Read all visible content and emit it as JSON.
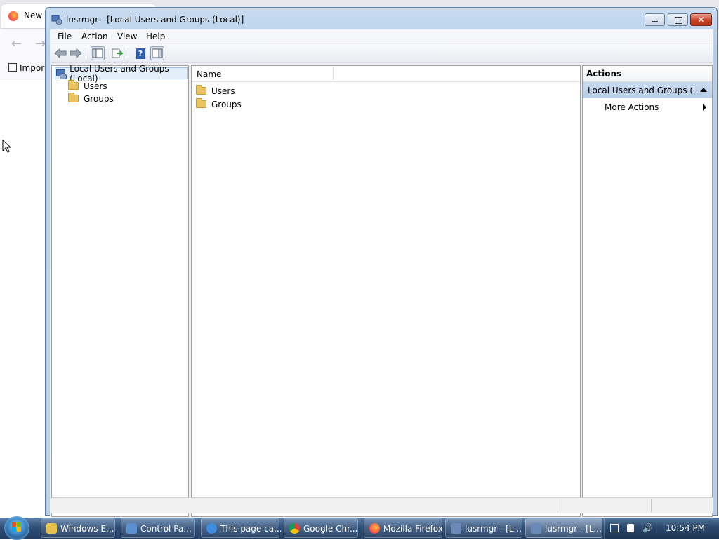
{
  "browser_bg": {
    "tab_title": "New T",
    "back_arrow": "←",
    "forward_arrow": "→",
    "bookmark_import": "Impor"
  },
  "window": {
    "title": "lusrmgr - [Local Users and Groups (Local)]",
    "close_glyph": "✕"
  },
  "menu": {
    "items": [
      "File",
      "Action",
      "View",
      "Help"
    ]
  },
  "toolbar": {
    "back_icon": "back-arrow-icon",
    "forward_icon": "forward-arrow-icon",
    "show_hide_tree_icon": "console-tree-icon",
    "export_list_icon": "export-list-icon",
    "help_icon": "help-icon",
    "help_glyph": "?",
    "show_hide_action_icon": "action-pane-icon"
  },
  "tree": {
    "root": "Local Users and Groups (Local)",
    "children": [
      "Users",
      "Groups"
    ]
  },
  "list": {
    "column_name": "Name",
    "rows": [
      "Users",
      "Groups"
    ]
  },
  "actions": {
    "title": "Actions",
    "group_label": "Local Users and Groups (Lo...",
    "more_actions": "More Actions"
  },
  "taskbar": {
    "buttons": [
      {
        "label": "Windows E...",
        "icon": "explorer-folder-icon",
        "color": "#e6c14d"
      },
      {
        "label": "Control Pa...",
        "icon": "control-panel-icon",
        "color": "#5a8fd0"
      },
      {
        "label": "This page ca...",
        "icon": "internet-explorer-icon",
        "color": "#3d8ee0"
      },
      {
        "label": "Google Chr...",
        "icon": "chrome-icon",
        "color": "#d94437"
      },
      {
        "label": "Mozilla Firefox",
        "icon": "firefox-icon",
        "color": "#ff7139"
      },
      {
        "label": "lusrmgr - [L...",
        "icon": "mmc-icon",
        "color": "#6a88b8"
      },
      {
        "label": "lusrmgr - [L...",
        "icon": "mmc-icon",
        "color": "#6a88b8"
      }
    ],
    "clock": "10:54 PM"
  }
}
